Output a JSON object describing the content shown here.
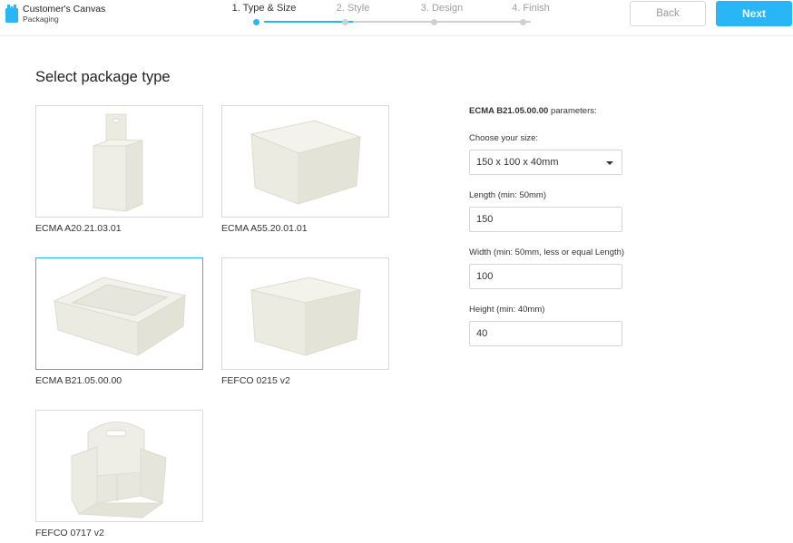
{
  "app": {
    "title": "Customer's Canvas",
    "subtitle": "Packaging"
  },
  "steps": [
    {
      "label": "1. Type & Size",
      "active": true
    },
    {
      "label": "2. Style",
      "active": false
    },
    {
      "label": "3. Design",
      "active": false
    },
    {
      "label": "4. Finish",
      "active": false
    }
  ],
  "nav": {
    "back_label": "Back",
    "next_label": "Next"
  },
  "main": {
    "title": "Select package type",
    "packages": [
      {
        "label": "ECMA A20.21.03.01",
        "selected": false
      },
      {
        "label": "ECMA A55.20.01.01",
        "selected": false
      },
      {
        "label": "ECMA B21.05.00.00",
        "selected": true
      },
      {
        "label": "FEFCO 0215 v2",
        "selected": false
      },
      {
        "label": "FEFCO 0717 v2",
        "selected": false
      }
    ]
  },
  "params": {
    "code": "ECMA B21.05.00.00",
    "suffix": " parameters:",
    "size_label": "Choose your size:",
    "size_value": "150 x 100 x 40mm",
    "length_label": "Length (min: 50mm)",
    "length_value": "150",
    "width_label": "Width (min: 50mm, less or equal Length)",
    "width_value": "100",
    "height_label": "Height (min: 40mm)",
    "height_value": "40"
  },
  "colors": {
    "accent": "#29b6f6",
    "box_fill": "#ecebe2",
    "box_edge": "#dddcd1"
  },
  "icons": {
    "logo": "package-logo-icon",
    "dropdown": "chevron-down-icon"
  }
}
